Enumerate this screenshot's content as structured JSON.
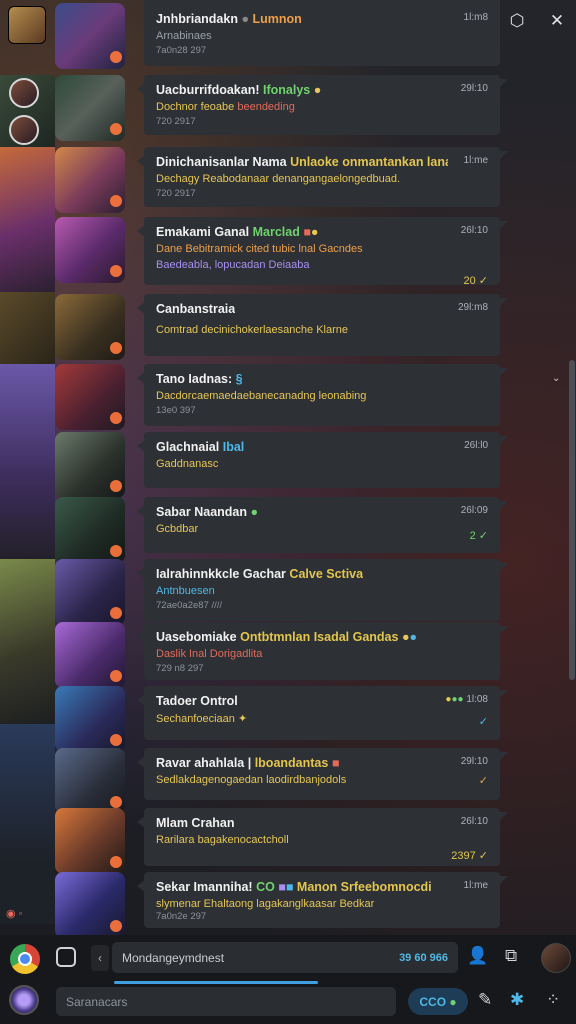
{
  "header": {
    "title_main": "Jnhbriandakn",
    "title_accent": "Lumnon",
    "subtitle": "Arnabinaes",
    "stamp": "7a0n28 297",
    "time": "1l:m8"
  },
  "messages": [
    {
      "title": "Uacburrifdoakan!",
      "accent": "Ifonalys",
      "time": "29l:10",
      "lines": [
        [
          "Dochnor feoabe",
          "c-yellow"
        ],
        [
          "beendeding",
          "c-red"
        ]
      ],
      "foot": "720 2917",
      "tick": ""
    },
    {
      "title": "Dinichanisanlar Nama",
      "accent": "Unlaoke onmantankan lanaly",
      "time": "1l:me",
      "lines": [
        [
          "Dechagy Reabodanaar denangangaelongedbuad.",
          "c-yellow"
        ]
      ],
      "foot": "720 2917",
      "tick": ""
    },
    {
      "title": "Emakami Ganal",
      "accent": "Marclad",
      "time": "26l:10",
      "lines": [
        [
          "Dane Bebitramick cited tubic lnal Gacndes",
          "c-orange"
        ],
        [
          "Baedeabla, lopucadan Deiaaba",
          "c-violet"
        ]
      ],
      "foot": "",
      "tick": "20 ✓"
    },
    {
      "title": "Canbanstraia",
      "accent": "",
      "time": "29l:m8",
      "lines": [
        [
          "Comtrad decinichokerlaesanche Klarne",
          "c-yellow"
        ]
      ],
      "foot": "",
      "tick": ""
    },
    {
      "title": "Tano Iadnas:",
      "accent": "",
      "time": "",
      "lines": [
        [
          "Dacdorcaemaedaebanecanadng leonabing",
          "c-yellow"
        ]
      ],
      "foot": "13e0 397",
      "tick": ""
    },
    {
      "title": "Glachnaial",
      "accent": "Ibal",
      "time": "26l:l0",
      "lines": [
        [
          "Gaddnanasc",
          "c-yellow"
        ]
      ],
      "foot": "",
      "tick": ""
    },
    {
      "title": "Sabar Naandan",
      "accent": "",
      "time": "26l:09",
      "lines": [
        [
          "Gcbdbar",
          "c-yellow"
        ]
      ],
      "foot": "",
      "tick": "2 ✓"
    },
    {
      "title": "Ialrahinnkkcle Gachar",
      "accent": "Calve Sctiva",
      "time": "",
      "lines": [
        [
          "Antnbuesen",
          "c-cyan"
        ]
      ],
      "foot": "72ae0a2e87 ////",
      "tick": ""
    },
    {
      "title": "Uasebomiake",
      "accent": "Ontbtmnlan Isadal Gandas",
      "time": "",
      "lines": [
        [
          "Daslik Inal Dorigadlita",
          "c-red"
        ]
      ],
      "foot": "729 n8 297",
      "tick": ""
    },
    {
      "title": "Tadoer Ontrol",
      "accent": "",
      "time": "1l:08",
      "lines": [
        [
          "Sechanfoeciaan",
          "c-yellow"
        ]
      ],
      "foot": "",
      "tick": "✓"
    },
    {
      "title": "Ravar ahahlala |",
      "accent": "lboandantas",
      "time": "29l:10",
      "lines": [
        [
          "Sedlakdagenogaedan laodirdbanjodols",
          "c-yellow"
        ]
      ],
      "foot": "",
      "tick": "✓"
    },
    {
      "title": "Mlam Crahan",
      "accent": "",
      "time": "26l:10",
      "lines": [
        [
          "Rarilara bagakenocactcholl",
          "c-yellow"
        ]
      ],
      "foot": "",
      "tick": "2397 ✓"
    },
    {
      "title": "Sekar Imanniha!",
      "accent": "Manon Srfeebomnocdi",
      "time": "1l:me",
      "lines": [
        [
          "slymenar Ehaltaong lagakanglkaasar Bedkar",
          "c-yellow"
        ]
      ],
      "foot": "7a0n2e 297",
      "tick": ""
    }
  ],
  "composer": {
    "input_text": "Mondangeymdnest",
    "counter": "39 60 966",
    "search_placeholder": "Saranacars",
    "pill_label": "CCO"
  }
}
